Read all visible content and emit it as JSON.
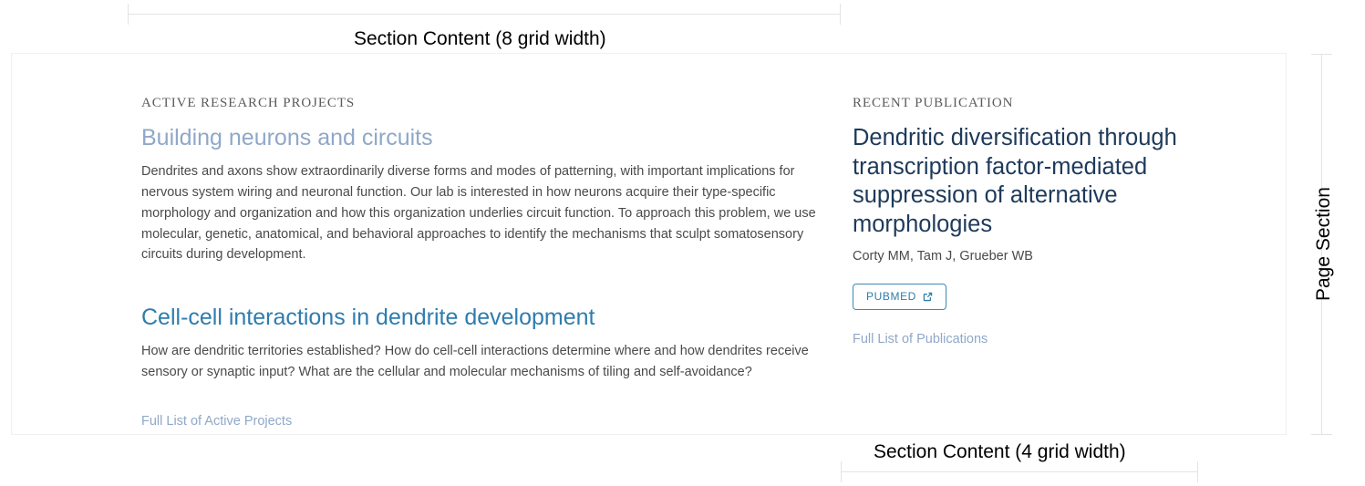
{
  "annotations": {
    "section_content_8": "Section Content (8 grid width)",
    "section_content_4": "Section Content (4 grid width)",
    "page_section": "Page Section"
  },
  "section": {
    "left_column": {
      "eyebrow": "ACTIVE RESEARCH PROJECTS",
      "projects": [
        {
          "title": "Building neurons and circuits",
          "body": "Dendrites and axons show extraordinarily diverse forms and modes of patterning, with important implications for nervous system wiring and neuronal function. Our lab is interested in how neurons acquire their type-specific morphology and organization and how this organization underlies circuit function. To approach this problem, we use molecular, genetic, anatomical, and behavioral approaches to identify the mechanisms that sculpt somatosensory circuits during development."
        },
        {
          "title": "Cell-cell interactions in dendrite development",
          "body": "How are dendritic territories established?  How do cell-cell interactions determine where and how dendrites receive sensory or synaptic input?   What are the cellular and molecular mechanisms of tiling and self-avoidance?"
        }
      ],
      "full_list_link": "Full List of Active Projects"
    },
    "right_column": {
      "eyebrow": "RECENT PUBLICATION",
      "publication": {
        "title": "Dendritic diversification through transcription factor-mediated suppression of alternative morphologies",
        "authors": "Corty MM,  Tam J,  Grueber WB",
        "button_label": "PUBMED",
        "button_icon": "external-link-icon"
      },
      "full_list_link": "Full List of Publications"
    }
  },
  "colors": {
    "accent_blue": "#2f7cad",
    "muted_blue": "#8fa8c8",
    "pub_title_navy": "#1e3a5a",
    "body_gray": "#4a4a4a",
    "panel_border": "#f0f0f0",
    "annotation_gray": "#e3e3e3"
  }
}
